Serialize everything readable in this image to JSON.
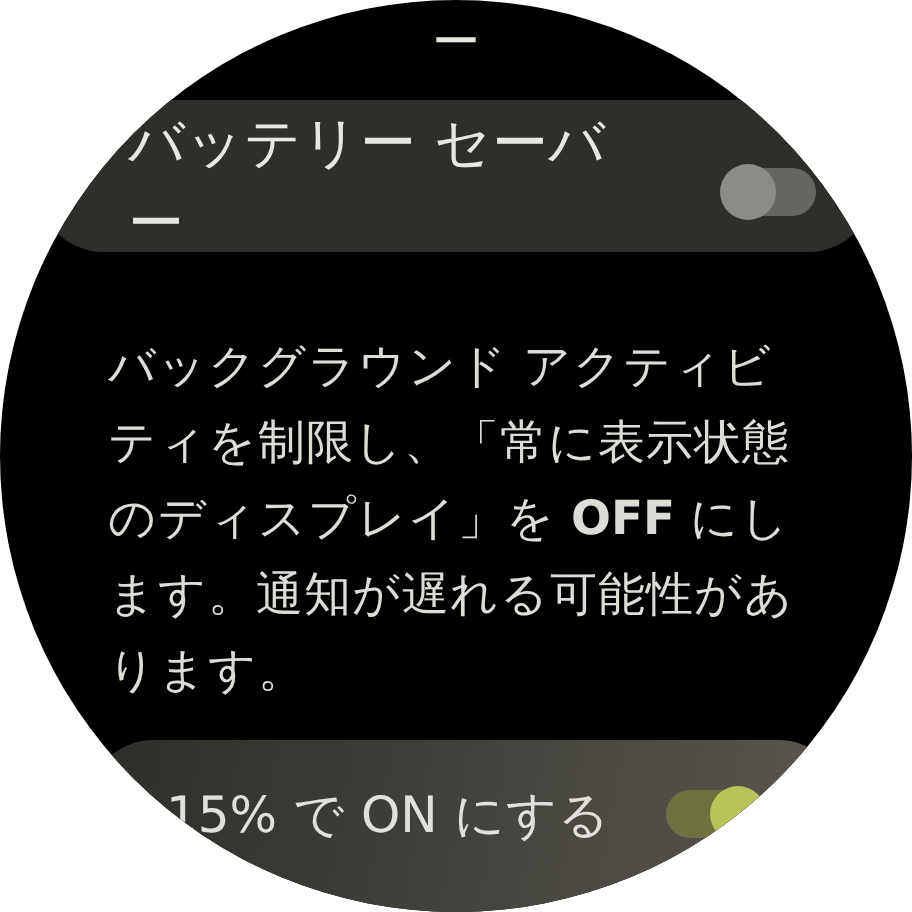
{
  "previous_fragment": "ー",
  "battery_saver": {
    "title": "バッテリー セーバー",
    "on": false
  },
  "description": "バックグラウンド アクティビティを制限し、「常に表示状態のディスプレイ」を **OFF** にします。通知が遅れる可能性があります。",
  "auto_on": {
    "label": "15% で ON にする",
    "on": true
  }
}
